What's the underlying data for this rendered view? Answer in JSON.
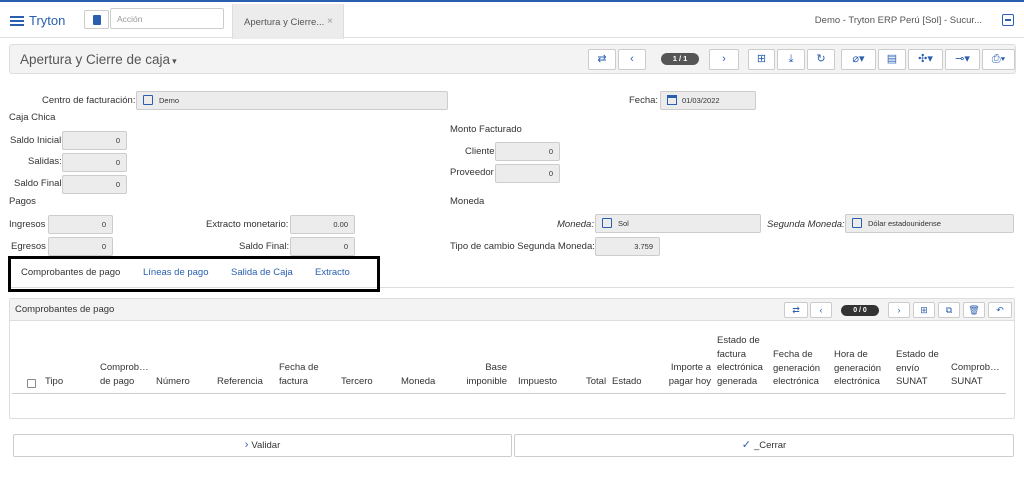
{
  "navbar": {
    "brand": "Tryton",
    "action_placeholder": "Acción",
    "tab_label": "Apertura y Cierre...",
    "tab_close": "×",
    "company": "Demo - Tryton ERP Perú [Sol] - Sucur..."
  },
  "toolbar": {
    "title": "Apertura y Cierre de caja",
    "title_caret": "▾",
    "pager": "1 / 1",
    "icons": [
      "switch-icon",
      "previous-icon",
      "next-icon",
      "new-icon",
      "save-icon",
      "reload-icon",
      "attach-icon",
      "note-icon",
      "action-icon",
      "relate-icon",
      "print-icon"
    ]
  },
  "form": {
    "centro_label": "Centro de facturación:",
    "centro_value": "Demo",
    "fecha_label": "Fecha:",
    "fecha_value": "01/03/2022",
    "caja_chica": "Caja Chica",
    "saldo_inicial_label": "Saldo Inicial",
    "saldo_inicial_value": "0",
    "salidas_label": "Salidas:",
    "salidas_value": "0",
    "saldo_final_label": "Saldo Final",
    "saldo_final_value": "0",
    "monto_facturado": "Monto Facturado",
    "cliente_label": "Cliente",
    "cliente_value": "0",
    "proveedor_label": "Proveedor",
    "proveedor_value": "0",
    "pagos": "Pagos",
    "moneda_section": "Moneda",
    "ingresos_label": "Ingresos",
    "ingresos_value": "0",
    "egresos_label": "Egresos",
    "egresos_value": "0",
    "extracto_label": "Extracto monetario:",
    "extracto_value": "0.00",
    "saldo_final2_label": "Saldo Final:",
    "saldo_final2_value": "0",
    "moneda_label": "Moneda:",
    "moneda_value": "Sol",
    "segunda_label": "Segunda Moneda:",
    "segunda_value": "Dólar estadounidense",
    "tipo_cambio_label": "Tipo de cambio Segunda Moneda:",
    "tipo_cambio_value": "3.759"
  },
  "tabs": [
    "Comprobantes de pago",
    "Líneas de pago",
    "Salida de Caja",
    "Extracto"
  ],
  "subform": {
    "title": "Comprobantes de pago",
    "pager": "0 / 0",
    "columns": [
      "Tipo",
      "Comprob… de pago",
      "Número",
      "Referencia",
      "Fecha de factura",
      "Tercero",
      "Moneda",
      "Base imponible",
      "Impuesto",
      "Total",
      "Estado",
      "Importe a pagar hoy",
      "Estado de factura electrónica generada",
      "Fecha de generación electrónica",
      "Hora de generación electrónica",
      "Estado de envío SUNAT",
      "Comprob… SUNAT"
    ]
  },
  "buttons": {
    "validar": "Validar",
    "cerrar": "_Cerrar"
  },
  "colors": {
    "accent": "#2a5fb0",
    "readonly_field": "#ececec"
  }
}
